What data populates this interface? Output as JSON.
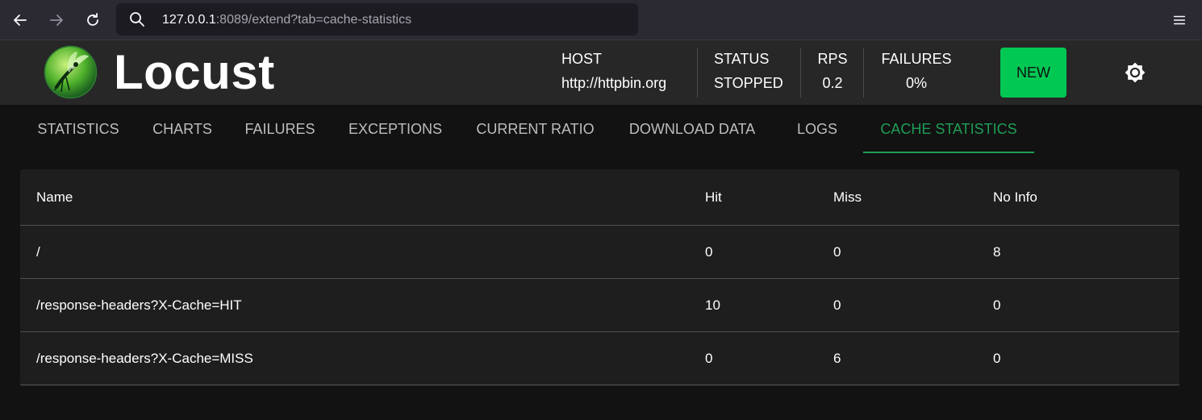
{
  "browser": {
    "url_host": "127.0.0.1",
    "url_rest": ":8089/extend?tab=cache-statistics",
    "icons": [
      "back-arrow-icon",
      "forward-arrow-icon",
      "reload-icon",
      "search-icon",
      "hamburger-menu-icon"
    ]
  },
  "header": {
    "brand": "Locust",
    "host_label": "HOST",
    "host_value": "http://httpbin.org",
    "status_label": "STATUS",
    "status_value": "STOPPED",
    "rps_label": "RPS",
    "rps_value": "0.2",
    "failures_label": "FAILURES",
    "failures_value": "0%",
    "new_label": "NEW",
    "accent_color": "#00c853"
  },
  "tabs": [
    {
      "label": "STATISTICS"
    },
    {
      "label": "CHARTS"
    },
    {
      "label": "FAILURES"
    },
    {
      "label": "EXCEPTIONS"
    },
    {
      "label": "CURRENT RATIO"
    },
    {
      "label": "DOWNLOAD DATA"
    },
    {
      "label": "LOGS"
    },
    {
      "label": "CACHE STATISTICS",
      "active": true
    }
  ],
  "table": {
    "columns": [
      "Name",
      "Hit",
      "Miss",
      "No Info"
    ],
    "rows": [
      [
        "/",
        "0",
        "0",
        "8"
      ],
      [
        "/response-headers?X-Cache=HIT",
        "10",
        "0",
        "0"
      ],
      [
        "/response-headers?X-Cache=MISS",
        "0",
        "6",
        "0"
      ]
    ]
  }
}
